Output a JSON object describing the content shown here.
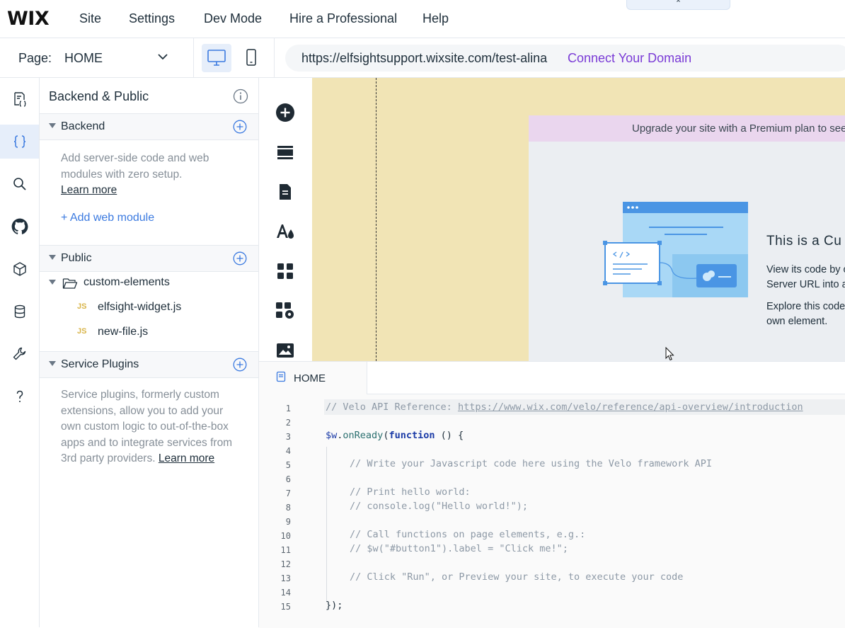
{
  "topbar": {
    "logo": "WIX",
    "menu": [
      "Site",
      "Settings",
      "Dev Mode",
      "Hire a Professional",
      "Help"
    ],
    "collapse_glyph": "⌃"
  },
  "pagebar": {
    "page_label": "Page:",
    "page_name": "HOME",
    "url": "https://elfsightsupport.wixsite.com/test-alina",
    "connect_domain": "Connect Your Domain"
  },
  "rail": {
    "icons": [
      "page-code-icon",
      "braces-icon",
      "search-icon",
      "github-icon",
      "package-icon",
      "database-icon",
      "wrench-icon",
      "help-icon"
    ]
  },
  "panel": {
    "title": "Backend & Public",
    "backend": {
      "label": "Backend",
      "desc": "Add server-side code and web modules with zero setup.",
      "learn_more": "Learn more",
      "add_module": "+ Add web module"
    },
    "public": {
      "label": "Public",
      "folder": "custom-elements",
      "files": [
        {
          "badge": "JS",
          "name": "elfsight-widget.js"
        },
        {
          "badge": "JS",
          "name": "new-file.js"
        }
      ]
    },
    "plugins": {
      "label": "Service Plugins",
      "desc": "Service plugins, formerly custom extensions, allow you to add your own custom logic to out-of-the-box apps and to integrate services from 3rd party providers.",
      "learn_more": "Learn more"
    }
  },
  "canvas": {
    "premium_text": "Upgrade your site with a Premium plan to see",
    "ce_title": "This is a Cu",
    "ce_line1": "View its code by c",
    "ce_line2": "Server URL into a",
    "ce_line3": "Explore this code",
    "ce_line4": "own element."
  },
  "editor": {
    "tab": "HOME",
    "lines": [
      {
        "n": "1"
      },
      {
        "n": "2"
      },
      {
        "n": "3"
      },
      {
        "n": "4"
      },
      {
        "n": "5"
      },
      {
        "n": "6"
      },
      {
        "n": "7"
      },
      {
        "n": "8"
      },
      {
        "n": "9"
      },
      {
        "n": "10"
      },
      {
        "n": "11"
      },
      {
        "n": "12"
      },
      {
        "n": "13"
      },
      {
        "n": "14"
      },
      {
        "n": "15"
      }
    ],
    "code": {
      "l1_comment": "// Velo API Reference: ",
      "l1_url": "https://www.wix.com/velo/reference/api-overview/introduction",
      "l3_dollar": "$w",
      "l3_dot": ".",
      "l3_fn": "onReady",
      "l3_open": "(",
      "l3_kw": "function",
      "l3_rest": " () {",
      "l5": "// Write your Javascript code here using the Velo framework API",
      "l7": "// Print hello world:",
      "l8": "// console.log(\"Hello world!\");",
      "l10": "// Call functions on page elements, e.g.:",
      "l11": "// $w(\"#button1\").label = \"Click me!\";",
      "l13": "// Click \"Run\", or Preview your site, to execute your code",
      "l15": "});"
    }
  },
  "colors": {
    "accent": "#3b7ae0",
    "domain_link": "#7a3bd6",
    "canvas_bg": "#f1e4b5",
    "premium_bar": "#ead6ee"
  }
}
